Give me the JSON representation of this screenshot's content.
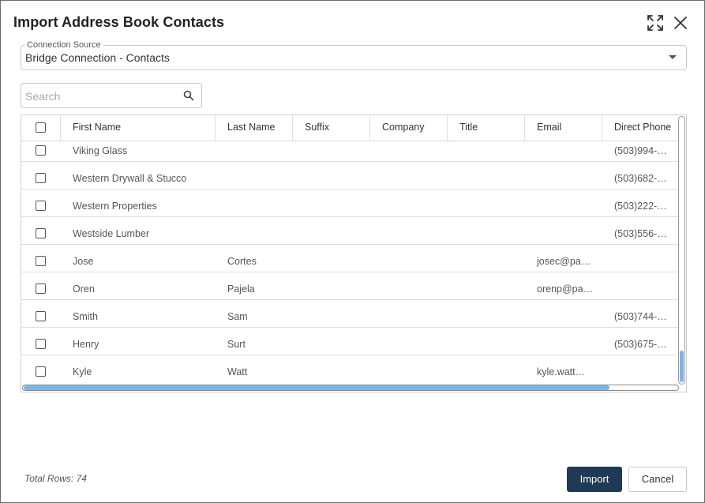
{
  "dialog": {
    "title": "Import Address Book Contacts",
    "icons": {
      "expand": "expand-icon",
      "close": "close-icon"
    }
  },
  "connection": {
    "legend": "Connection Source",
    "value": "Bridge Connection - Contacts"
  },
  "search": {
    "placeholder": "Search",
    "icon": "search-icon"
  },
  "grid": {
    "columns": [
      "First Name",
      "Last Name",
      "Suffix",
      "Company",
      "Title",
      "Email",
      "Direct Phone"
    ],
    "rows": [
      [
        "Viking Glass",
        "",
        "",
        "",
        "",
        "",
        "(503)994-…"
      ],
      [
        "Western Drywall & Stucco",
        "",
        "",
        "",
        "",
        "",
        "(503)682-…"
      ],
      [
        "Western Properties",
        "",
        "",
        "",
        "",
        "",
        "(503)222-…"
      ],
      [
        "Westside Lumber",
        "",
        "",
        "",
        "",
        "",
        "(503)556-…"
      ],
      [
        "Jose",
        "Cortes",
        "",
        "",
        "",
        "josec@pa…",
        ""
      ],
      [
        "Oren",
        "Pajela",
        "",
        "",
        "",
        "orenp@pa…",
        ""
      ],
      [
        "Smith",
        "Sam",
        "",
        "",
        "",
        "",
        "(503)744-…"
      ],
      [
        "Henry",
        "Surt",
        "",
        "",
        "",
        "",
        "(503)675-…"
      ],
      [
        "Kyle",
        "Watt",
        "",
        "",
        "",
        "kyle.watt…",
        ""
      ]
    ]
  },
  "footer": {
    "total_rows": "Total Rows: 74",
    "import_label": "Import",
    "cancel_label": "Cancel"
  },
  "colors": {
    "primary_button": "#1e3a56",
    "scroll_thumb": "#7fb4ea"
  }
}
